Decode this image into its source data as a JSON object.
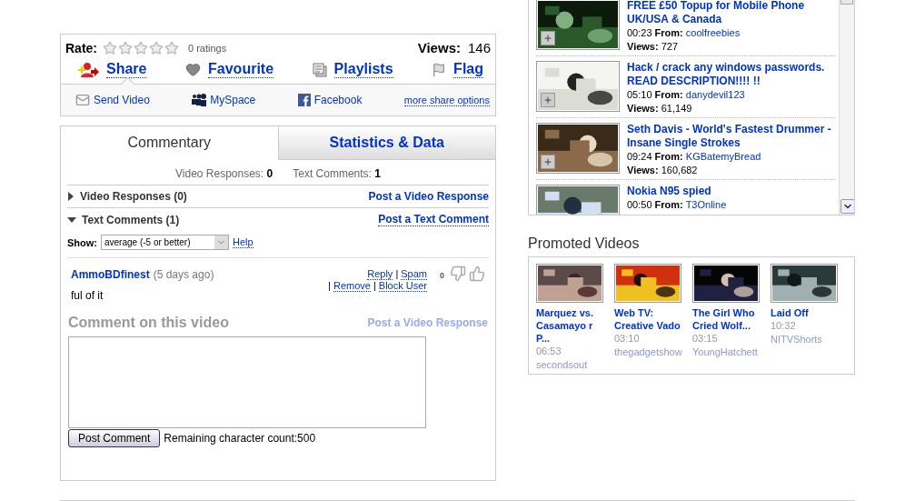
{
  "rating": {
    "label": "Rate:",
    "stars": 0,
    "count": "0 ratings",
    "views_label": "Views:",
    "views": "146"
  },
  "actions": [
    {
      "kind": "share",
      "label": "Share",
      "selected": true
    },
    {
      "kind": "favourite",
      "label": "Favourite",
      "selected": false
    },
    {
      "kind": "playlists",
      "label": "Playlists",
      "selected": false
    },
    {
      "kind": "flag",
      "label": "Flag",
      "selected": false
    }
  ],
  "share_links": [
    {
      "kind": "email",
      "label": "Send Video"
    },
    {
      "kind": "myspace",
      "label": "MySpace"
    },
    {
      "kind": "facebook",
      "label": "Facebook"
    },
    {
      "kind": "more",
      "label": "more share options"
    }
  ],
  "tabs": [
    {
      "label": "Commentary",
      "selected": true
    },
    {
      "label": "Statistics & Data",
      "selected": false
    }
  ],
  "summary": [
    {
      "label": "Video Responses:",
      "value": "0"
    },
    {
      "label": "Text Comments:",
      "value": "1"
    }
  ],
  "sections": [
    {
      "title": "Video Responses (0)",
      "expanded": false,
      "link": "Post a Video Response"
    },
    {
      "title": "Text Comments (1)",
      "expanded": true,
      "link": "Post a Text Comment"
    }
  ],
  "filter": {
    "label": "Show:",
    "value": "average (-5 or better)",
    "help": "Help"
  },
  "comments": [
    {
      "author": "AmmoBDfinest",
      "age": "(5 days ago)",
      "text": "ful of it",
      "score": "0",
      "action_lines": [
        [
          {
            "kind": "link",
            "text": "Reply"
          },
          {
            "kind": "sep",
            "text": "|"
          },
          {
            "kind": "link",
            "text": "Spam"
          }
        ],
        [
          {
            "kind": "sep",
            "text": "|"
          },
          {
            "kind": "link",
            "text": "Remove"
          },
          {
            "kind": "sep",
            "text": "|"
          },
          {
            "kind": "link",
            "text": "Block User"
          }
        ]
      ]
    }
  ],
  "compose": {
    "title": "Comment on this video",
    "link": "Post a Video Response",
    "button": "Post Comment",
    "remaining": "Remaining character count:500"
  },
  "related": [
    {
      "title": "FREE £50 Topup for Mobile Phone UK/USA & Canada",
      "duration": "00:23",
      "from_label": "From:",
      "channel": "coolfreebies",
      "views_label": "Views:",
      "views": "727"
    },
    {
      "title": "Hack / crack any windows passwords. READ DESCRIPTION!!!! !!",
      "duration": "05:10",
      "from_label": "From:",
      "channel": "danydevil123",
      "views_label": "Views:",
      "views": "61,149"
    },
    {
      "title": "Seth Davis - World's Fastest Drummer - Insane Single Strokes",
      "duration": "09:24",
      "from_label": "From:",
      "channel": "KGBatemyBread",
      "views_label": "Views:",
      "views": "160,682"
    },
    {
      "title": "Nokia N95 spied",
      "duration": "00:50",
      "from_label": "From:",
      "channel": "T3Online"
    }
  ],
  "promoted": {
    "title": "Promoted Videos",
    "items": [
      {
        "title": "Marquez vs. Casamayo r P...",
        "duration": "06:53",
        "channel": "secondsout"
      },
      {
        "title": "Web TV: Creative Vado",
        "duration": "03:10",
        "channel": "thegadgetshow"
      },
      {
        "title": "The Girl Who Cried Wolf...",
        "duration": "03:15",
        "channel": "YoungHatchett"
      },
      {
        "title": "Laid Off",
        "duration": "10:32",
        "channel": "NITVShorts"
      }
    ]
  }
}
